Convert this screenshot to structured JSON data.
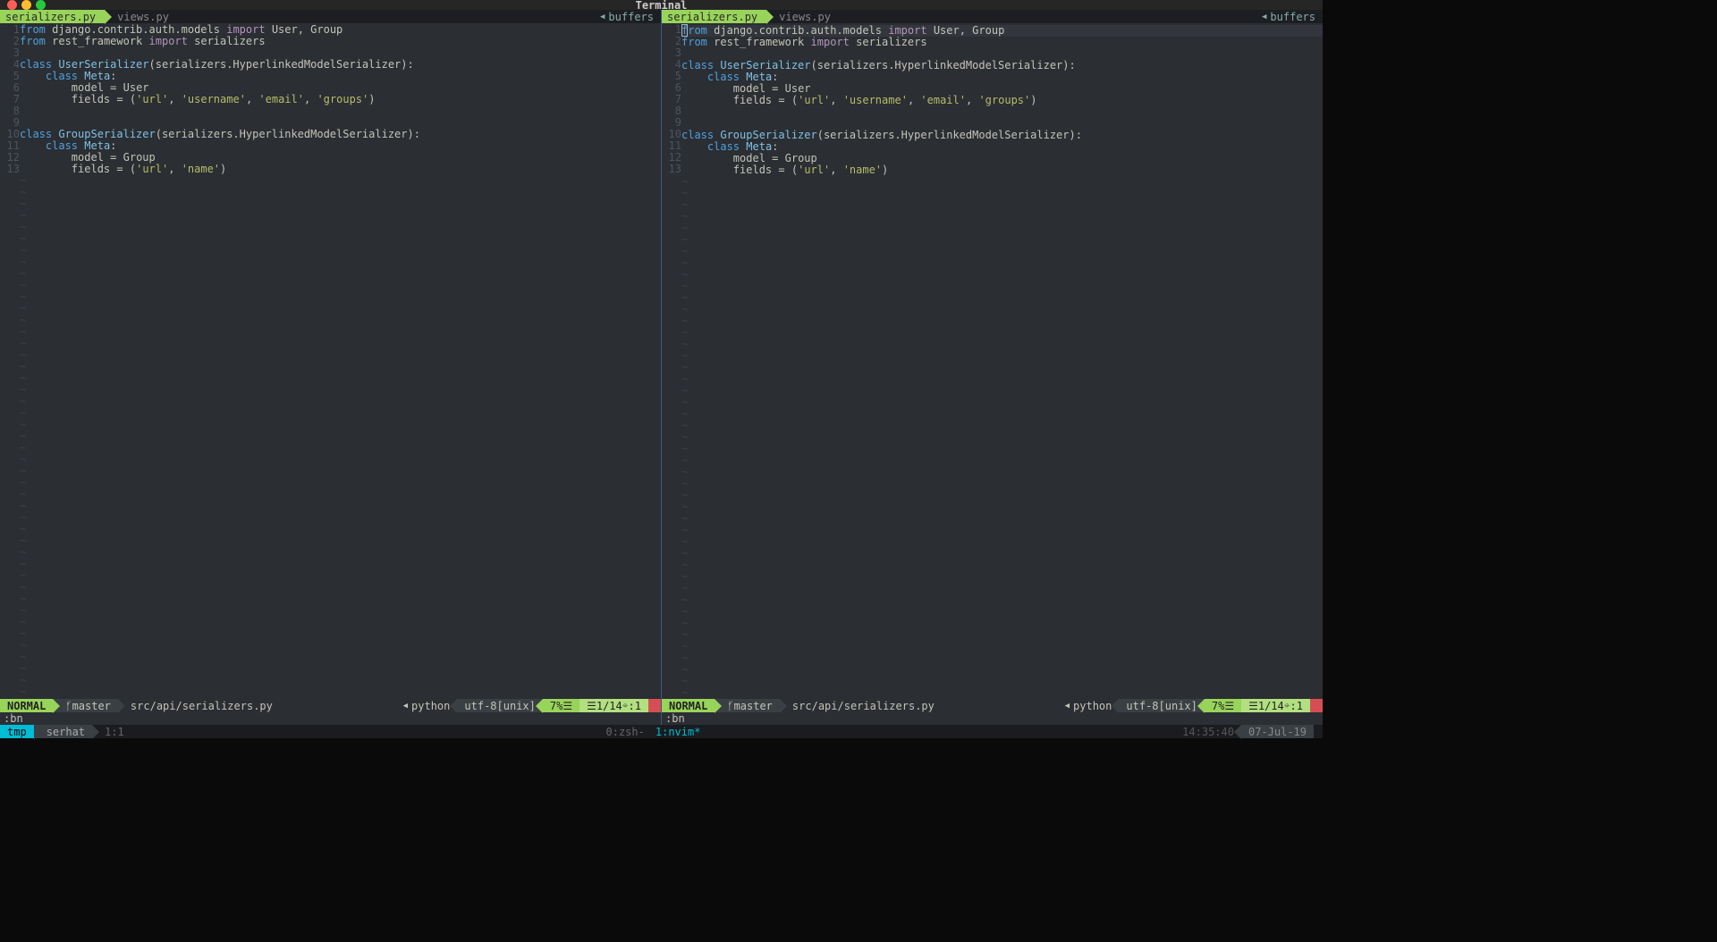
{
  "window": {
    "title": "Terminal"
  },
  "buffers_label": "buffers",
  "tabs": [
    {
      "name": "serializers.py",
      "active": true
    },
    {
      "name": "views.py",
      "active": false
    }
  ],
  "code_lines": [
    {
      "n": "1",
      "html": "<span class='kw'>from</span> <span class='nm'>django.contrib.auth.models</span> <span class='imp'>import</span> <span class='nm'>User, Group</span>"
    },
    {
      "n": "2",
      "html": "<span class='kw'>from</span> <span class='nm'>rest_framework</span> <span class='imp'>import</span> <span class='nm'>serializers</span>"
    },
    {
      "n": "3",
      "html": ""
    },
    {
      "n": "4",
      "html": "<span class='cls'>class</span> <span class='fn'>UserSerializer</span><span class='pn'>(serializers.HyperlinkedModelSerializer):</span>"
    },
    {
      "n": "5",
      "html": "    <span class='cls'>class</span> <span class='fn'>Meta</span><span class='pn'>:</span>"
    },
    {
      "n": "6",
      "html": "        <span class='nm'>model</span> <span class='pn'>=</span> <span class='nm'>User</span>"
    },
    {
      "n": "7",
      "html": "        <span class='nm'>fields</span> <span class='pn'>=</span> <span class='pn'>(</span><span class='str'>'url'</span><span class='pn'>,</span> <span class='str'>'username'</span><span class='pn'>,</span> <span class='str'>'email'</span><span class='pn'>,</span> <span class='str'>'groups'</span><span class='pn'>)</span>"
    },
    {
      "n": "8",
      "html": ""
    },
    {
      "n": "9",
      "html": ""
    },
    {
      "n": "10",
      "html": "<span class='cls'>class</span> <span class='fn'>GroupSerializer</span><span class='pn'>(serializers.HyperlinkedModelSerializer):</span>"
    },
    {
      "n": "11",
      "html": "    <span class='cls'>class</span> <span class='fn'>Meta</span><span class='pn'>:</span>"
    },
    {
      "n": "12",
      "html": "        <span class='nm'>model</span> <span class='pn'>=</span> <span class='nm'>Group</span>"
    },
    {
      "n": "13",
      "html": "        <span class='nm'>fields</span> <span class='pn'>=</span> <span class='pn'>(</span><span class='str'>'url'</span><span class='pn'>,</span> <span class='str'>'name'</span><span class='pn'>)</span>"
    }
  ],
  "statusline": {
    "mode": "NORMAL",
    "branch": "master",
    "filepath": "src/api/serializers.py",
    "filetype": "python",
    "encoding": "utf-8[unix]",
    "percent": "7%",
    "line_total": "1/14",
    "col": "1"
  },
  "command": ":bn",
  "tmux": {
    "session": "tmp",
    "user": "serhat",
    "pane": "1:1",
    "windows": [
      {
        "idx": "0",
        "name": "zsh-",
        "active": false
      },
      {
        "idx": "1",
        "name": "nvim*",
        "active": true
      }
    ],
    "time": "14:35:40",
    "date": "07-Jul-19"
  }
}
